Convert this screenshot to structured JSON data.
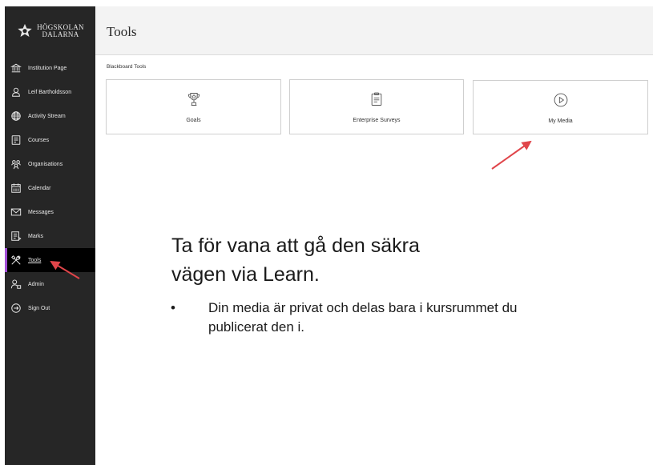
{
  "brand": {
    "logo_lines": [
      "HÖGSKOLAN",
      "DALARNA"
    ],
    "accent": "#a24fd6"
  },
  "sidebar": {
    "items": [
      {
        "label": "Institution Page",
        "icon": "institution-icon"
      },
      {
        "label": "Leif Bartholdsson",
        "icon": "user-icon"
      },
      {
        "label": "Activity Stream",
        "icon": "globe-icon"
      },
      {
        "label": "Courses",
        "icon": "courses-icon"
      },
      {
        "label": "Organisations",
        "icon": "organisations-icon"
      },
      {
        "label": "Calendar",
        "icon": "calendar-icon"
      },
      {
        "label": "Messages",
        "icon": "envelope-icon"
      },
      {
        "label": "Marks",
        "icon": "marks-icon"
      },
      {
        "label": "Tools",
        "icon": "tools-icon",
        "active": true
      },
      {
        "label": "Admin",
        "icon": "admin-icon"
      },
      {
        "label": "Sign Out",
        "icon": "sign-out-icon"
      }
    ]
  },
  "header": {
    "title": "Tools"
  },
  "main": {
    "section_label": "Blackboard Tools",
    "tiles": [
      {
        "label": "Goals",
        "icon": "trophy-icon"
      },
      {
        "label": "Enterprise Surveys",
        "icon": "clipboard-icon"
      },
      {
        "label": "My Media",
        "icon": "play-icon"
      }
    ]
  },
  "slide": {
    "line1": "Ta för vana att gå den säkra",
    "line2": "vägen via Learn.",
    "bullet_marker": "•",
    "bullet": "Din media är privat och delas bara i kursrummet du publicerat den i."
  }
}
